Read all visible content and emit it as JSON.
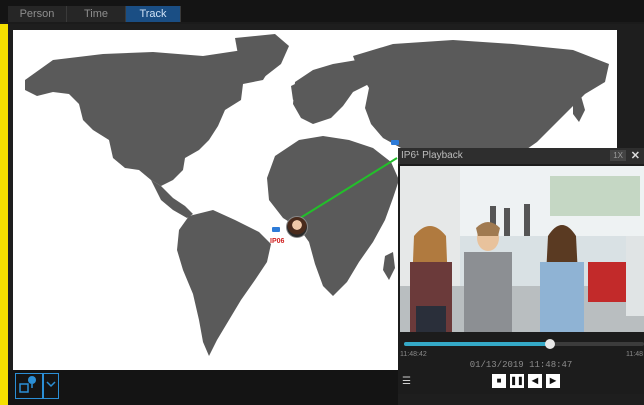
{
  "tabs": [
    {
      "label": "Person",
      "active": false
    },
    {
      "label": "Time",
      "active": false
    },
    {
      "label": "Track",
      "active": true
    }
  ],
  "map": {
    "markers": [
      {
        "label": "IP06",
        "icon": "camera-icon"
      },
      {
        "label": "",
        "icon": "camera-icon"
      }
    ],
    "track_color": "#22c02a",
    "land_color": "#5a5a5a"
  },
  "bottom_controls": [
    {
      "icon": "map-camera-icon"
    },
    {
      "icon": "chevron-down-icon"
    }
  ],
  "playback": {
    "title": "IP6¹ Playback",
    "speed": "1X",
    "close_glyph": "✕",
    "start_time": "11:48:42",
    "end_time": "11:48",
    "current_datetime": "01/13/2019 11:48:47",
    "progress": 0.61,
    "buttons": [
      {
        "glyph": "■",
        "name": "stop-button"
      },
      {
        "glyph": "❚❚",
        "name": "pause-button"
      },
      {
        "glyph": "◀",
        "name": "previous-button"
      },
      {
        "glyph": "▶",
        "name": "next-button"
      }
    ],
    "list_glyph": "☰"
  },
  "colors": {
    "accent": "#1a4e84",
    "highlight": "#f5e000",
    "progress": "#35a9c7"
  }
}
